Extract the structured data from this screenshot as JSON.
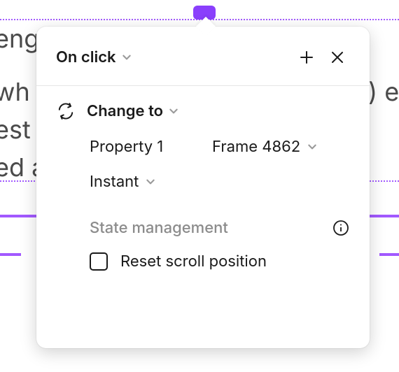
{
  "background": {
    "line1_fragment": "eng",
    "line2_fragment_left": " wh",
    "line2_fragment_right": ") er",
    "line3_fragment": "est",
    "line4_fragment": "ed a"
  },
  "popover": {
    "trigger_label": "On click",
    "action": {
      "label": "Change to",
      "property_label": "Property 1",
      "property_value": "Frame 4862",
      "animation_label": "Instant"
    },
    "state_section": {
      "title": "State management",
      "reset_scroll_label": "Reset scroll position",
      "reset_scroll_checked": false
    }
  }
}
